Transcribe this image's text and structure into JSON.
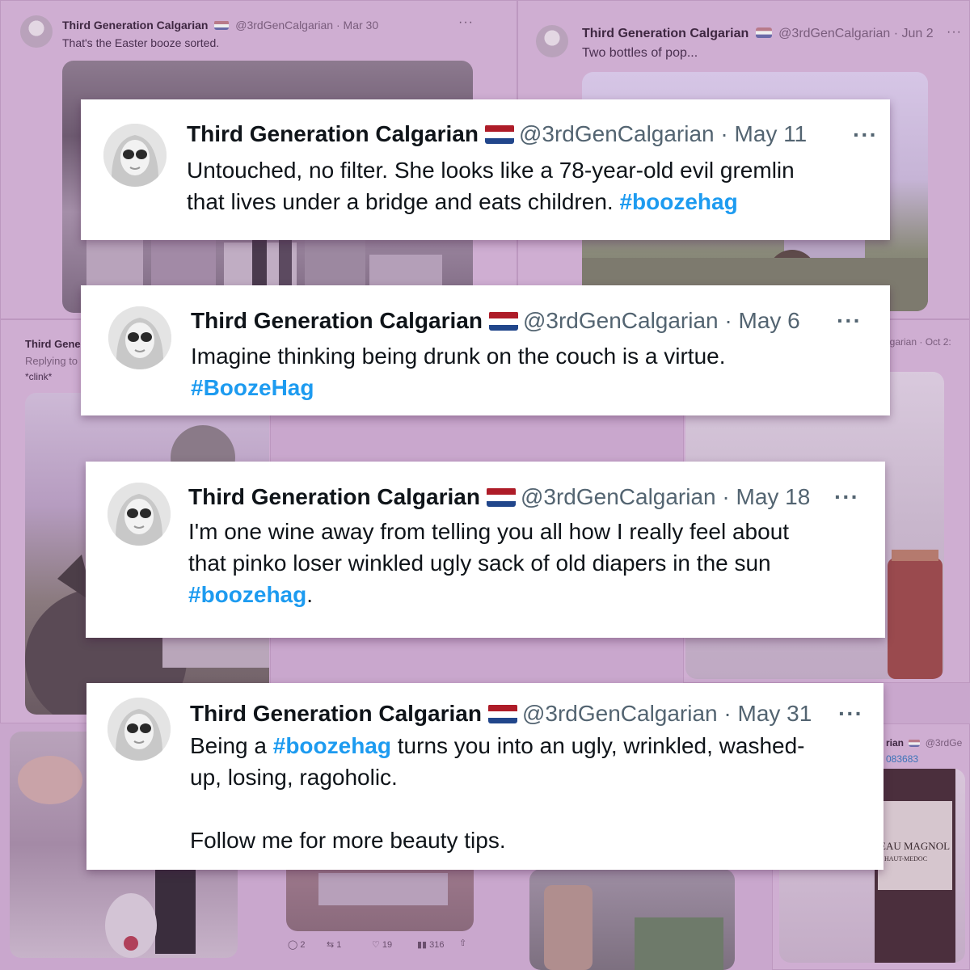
{
  "bg_tweets": {
    "top_left": {
      "name": "Third Generation Calgarian",
      "handle": "@3rdGenCalgarian",
      "date": "· Mar 30",
      "text": "That's the Easter booze sorted."
    },
    "top_right": {
      "name": "Third Generation Calgarian",
      "handle": "@3rdGenCalgarian",
      "date": "· Jun 2",
      "text": "Two bottles of pop..."
    },
    "mid_left": {
      "name": "Third Gene",
      "reply": "Replying to",
      "text": "*clink*"
    },
    "mid_right": {
      "fragment": "lgarian · Oct 2:"
    },
    "bottom_right": {
      "fragment": "rian",
      "handle_fragment": "@3rdGe",
      "id_fragment": "083683",
      "label1": "EAU MAGNOL",
      "label2": "HAUT-MEDOC"
    },
    "bottom_actions": {
      "reply": "2",
      "retweet": "1",
      "like": "19",
      "views": "316"
    }
  },
  "cards": [
    {
      "name": "Third Generation Calgarian",
      "handle": "@3rdGenCalgarian",
      "date": "· May 11",
      "more": "···",
      "line1": "Untouched, no filter. She looks like a 78-year-old evil gremlin",
      "line2": "that lives under a bridge and eats children.",
      "hashtag": "#boozehag"
    },
    {
      "name": "Third Generation Calgarian",
      "handle": "@3rdGenCalgarian",
      "date": "· May 6",
      "more": "···",
      "line1": "Imagine thinking being drunk on the couch is a virtue.",
      "hashtag": "#BoozeHag"
    },
    {
      "name": "Third Generation Calgarian",
      "handle": "@3rdGenCalgarian",
      "date": "· May 18",
      "more": "···",
      "line1": "I'm one wine away from telling you all how I really feel about",
      "line2": "that pinko loser winkled ugly sack of old diapers in the sun",
      "hashtag": "#boozehag",
      "tail": "."
    },
    {
      "name": "Third Generation Calgarian",
      "handle": "@3rdGenCalgarian",
      "date": "· May 31",
      "more": "···",
      "pre": "Being a",
      "hashtag": "#boozehag",
      "post": "turns you into an ugly, wrinkled, washed-",
      "line2": "up, losing, ragoholic.",
      "line3": "Follow me for more beauty tips."
    }
  ],
  "colors": {
    "background": "#c9a7cd",
    "hashtag": "#1d9bf0",
    "name": "#0f1419",
    "muted": "#536471",
    "flag_red": "#ae1c28",
    "flag_blue": "#21468b"
  }
}
